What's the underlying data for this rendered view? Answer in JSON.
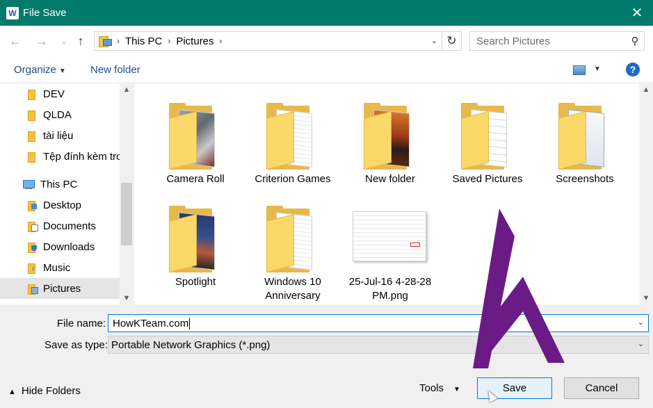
{
  "window": {
    "title": "File Save",
    "app_icon": "word-icon",
    "app_letter": "W"
  },
  "address_bar": {
    "breadcrumbs": [
      "This PC",
      "Pictures"
    ]
  },
  "search": {
    "placeholder": "Search Pictures"
  },
  "toolbar": {
    "organize_label": "Organize",
    "new_folder_label": "New folder",
    "help_label": "?"
  },
  "nav_pane": {
    "items": [
      {
        "label": "DEV",
        "icon": "folder-icon"
      },
      {
        "label": "QLDA",
        "icon": "folder-icon"
      },
      {
        "label": "tài liệu",
        "icon": "folder-icon"
      },
      {
        "label": "Tệp đính kèm trong",
        "icon": "folder-icon"
      },
      {
        "label": "This PC",
        "icon": "computer-icon"
      },
      {
        "label": "Desktop",
        "icon": "desktop-folder-icon"
      },
      {
        "label": "Documents",
        "icon": "documents-folder-icon"
      },
      {
        "label": "Downloads",
        "icon": "downloads-folder-icon"
      },
      {
        "label": "Music",
        "icon": "music-folder-icon"
      },
      {
        "label": "Pictures",
        "icon": "pictures-folder-icon",
        "selected": true
      }
    ]
  },
  "files": [
    {
      "label": "Camera Roll",
      "type": "folder"
    },
    {
      "label": "Criterion Games",
      "type": "folder"
    },
    {
      "label": "New folder",
      "type": "folder"
    },
    {
      "label": "Saved Pictures",
      "type": "folder"
    },
    {
      "label": "Screenshots",
      "type": "folder"
    },
    {
      "label": "Spotlight",
      "type": "folder"
    },
    {
      "label": "Windows 10 Anniversary",
      "type": "folder"
    },
    {
      "label": "25-Jul-16 4-28-28 PM.png",
      "type": "png"
    }
  ],
  "form": {
    "file_name_label": "File name:",
    "file_name_value": "HowKTeam.com",
    "save_type_label": "Save as type:",
    "save_type_value": "Portable Network Graphics (*.png)"
  },
  "footer": {
    "hide_folders_label": "Hide Folders",
    "tools_label": "Tools",
    "save_label": "Save",
    "cancel_label": "Cancel"
  },
  "colors": {
    "titlebar": "#007a6b",
    "accent": "#0078d7",
    "logo": "#6a1b86"
  }
}
